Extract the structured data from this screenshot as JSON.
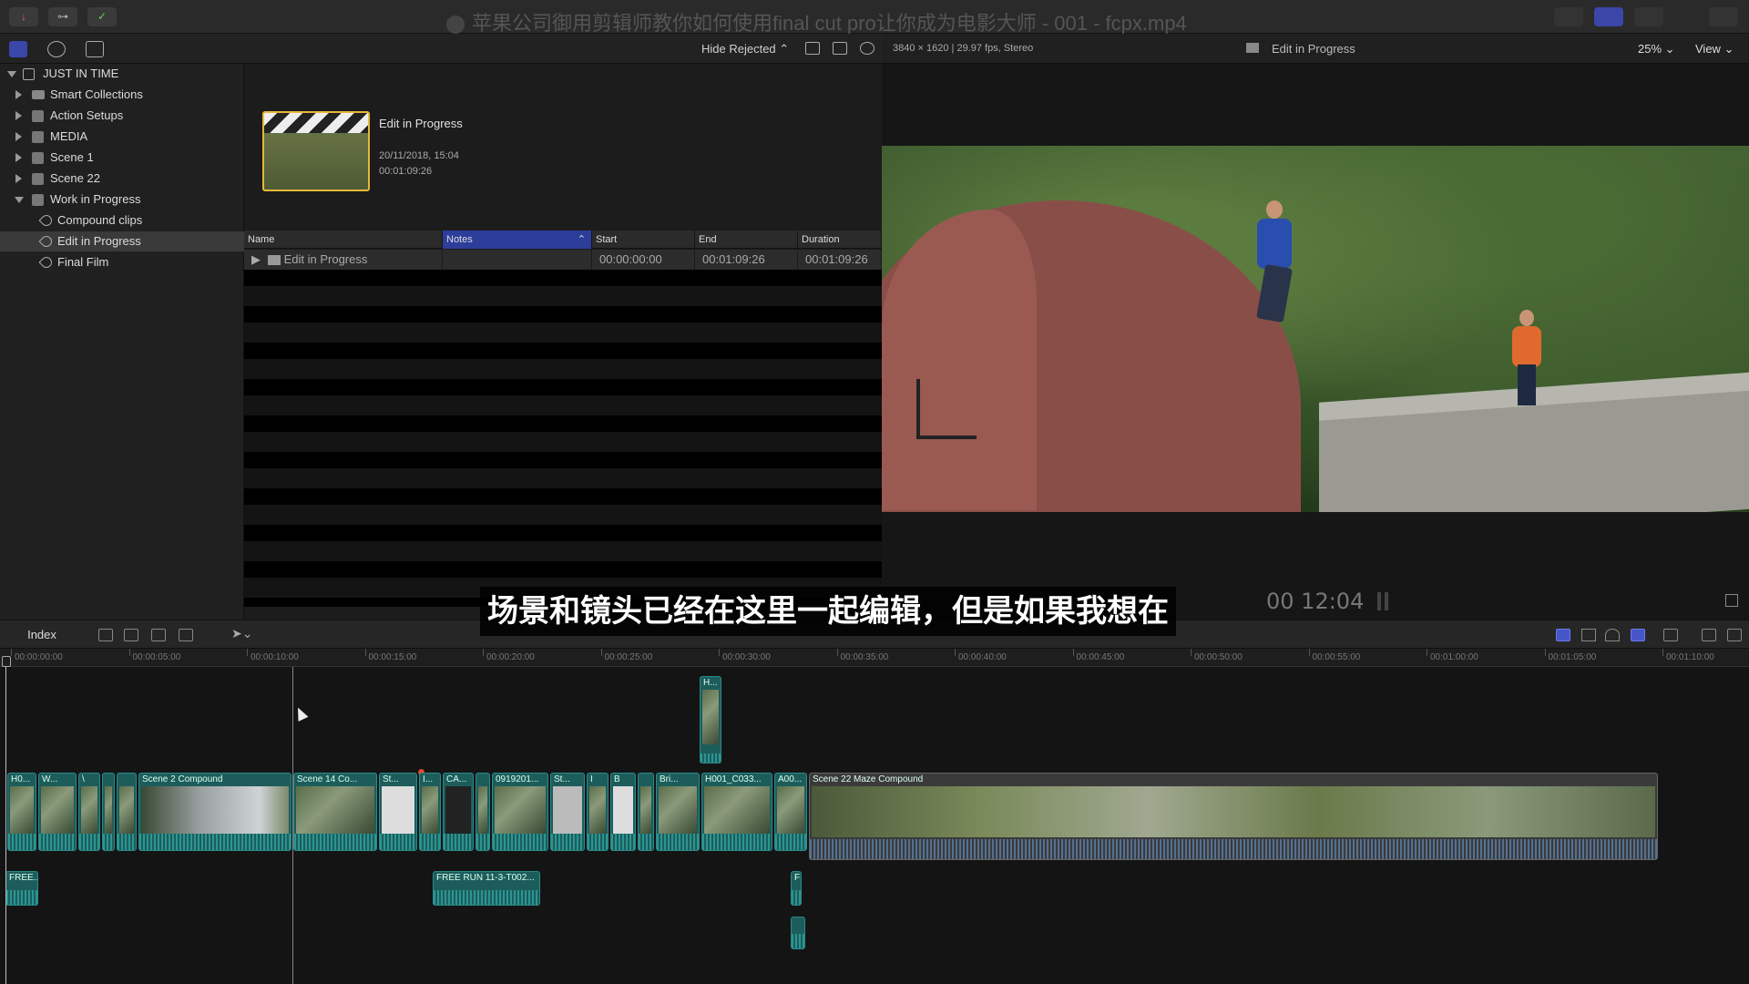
{
  "window": {
    "title": "苹果公司御用剪辑师教你如何使用final cut pro让你成为电影大师 - 001 - fcpx.mp4"
  },
  "browser_toolbar": {
    "hide_rejected": "Hide Rejected"
  },
  "sidebar": {
    "library": "JUST IN TIME",
    "items": [
      {
        "label": "Smart Collections",
        "icon": "folder-icon"
      },
      {
        "label": "Action Setups",
        "icon": "event-star-icon"
      },
      {
        "label": "MEDIA",
        "icon": "event-star-icon"
      },
      {
        "label": "Scene 1",
        "icon": "event-star-icon"
      },
      {
        "label": "Scene 22",
        "icon": "event-star-icon"
      },
      {
        "label": "Work in Progress",
        "icon": "event-star-icon"
      }
    ],
    "keywords": [
      {
        "label": "Compound clips"
      },
      {
        "label": "Edit in Progress"
      },
      {
        "label": "Final Film"
      }
    ]
  },
  "project": {
    "title": "Edit in Progress",
    "date": "20/11/2018, 15:04",
    "duration": "00:01:09:26"
  },
  "list": {
    "headers": [
      "Name",
      "Notes",
      "Start",
      "End",
      "Duration"
    ],
    "row": {
      "name": "Edit in Progress",
      "notes": "",
      "start": "00:00:00:00",
      "end": "00:01:09:26",
      "duration": "00:01:09:26"
    }
  },
  "viewer": {
    "format": "3840 × 1620 | 29.97 fps, Stereo",
    "project_name": "Edit in Progress",
    "zoom": "25%",
    "view": "View",
    "timecode": "00 12:04"
  },
  "subtitle": "场景和镜头已经在这里一起编辑，但是如果我想在",
  "timeline_toolbar": {
    "index": "Index"
  },
  "ruler": {
    "labels": [
      "00:00:00:00",
      "00:00:05:00",
      "00:00:10:00",
      "00:00:15:00",
      "00:00:20:00",
      "00:00:25:00",
      "00:00:30:00",
      "00:00:35:00",
      "00:00:40:00",
      "00:00:45:00",
      "00:00:50:00",
      "00:00:55:00",
      "00:01:00:00",
      "00:01:05:00",
      "00:01:10:00"
    ]
  },
  "clips": {
    "primary": [
      "H0...",
      "W...",
      "\\",
      "",
      "Scene 2 Compound",
      "Scene 14 Co...",
      "St...",
      "I...",
      "CA...",
      "",
      "0919201...",
      "St...",
      "I",
      "B",
      "",
      "Bri...",
      "H001_C033...",
      "A00...",
      "Scene 22 Maze Compound"
    ],
    "connected_above": [
      "H..."
    ],
    "connected_below": [
      "FREE...",
      "FREE RUN 11-3-T002...",
      "F"
    ]
  },
  "colors": {
    "clip_teal": "#1c5d5c",
    "selection_blue": "#2d3d9a",
    "thumb_border": "#e7b93a"
  }
}
